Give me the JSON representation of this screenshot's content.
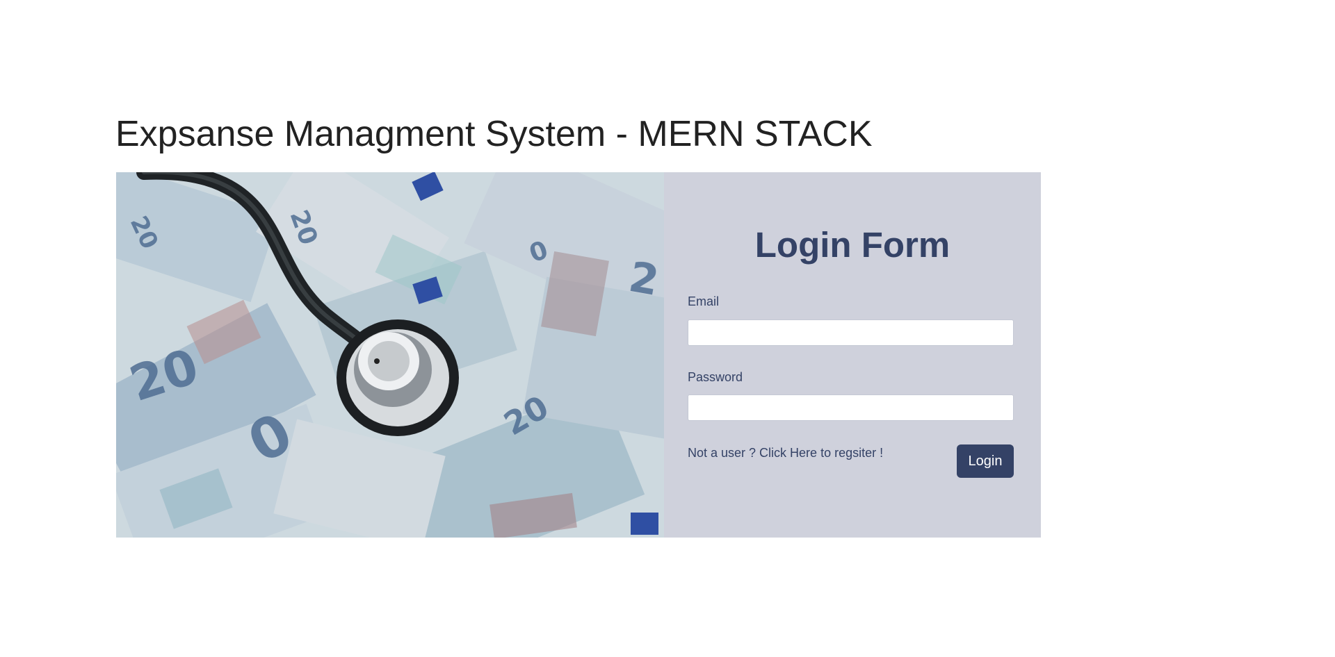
{
  "page": {
    "title": "Expsanse Managment System - MERN STACK"
  },
  "hero": {
    "image_description_icon": "money-stethoscope-image"
  },
  "login_form": {
    "heading": "Login Form",
    "email_label": "Email",
    "email_value": "",
    "password_label": "Password",
    "password_value": "",
    "register_link": "Not a user ? Click Here to regsiter !",
    "submit_label": "Login"
  },
  "colors": {
    "accent": "#344266",
    "panel_bg": "#cfd1dc",
    "page_bg": "#ffffff"
  }
}
